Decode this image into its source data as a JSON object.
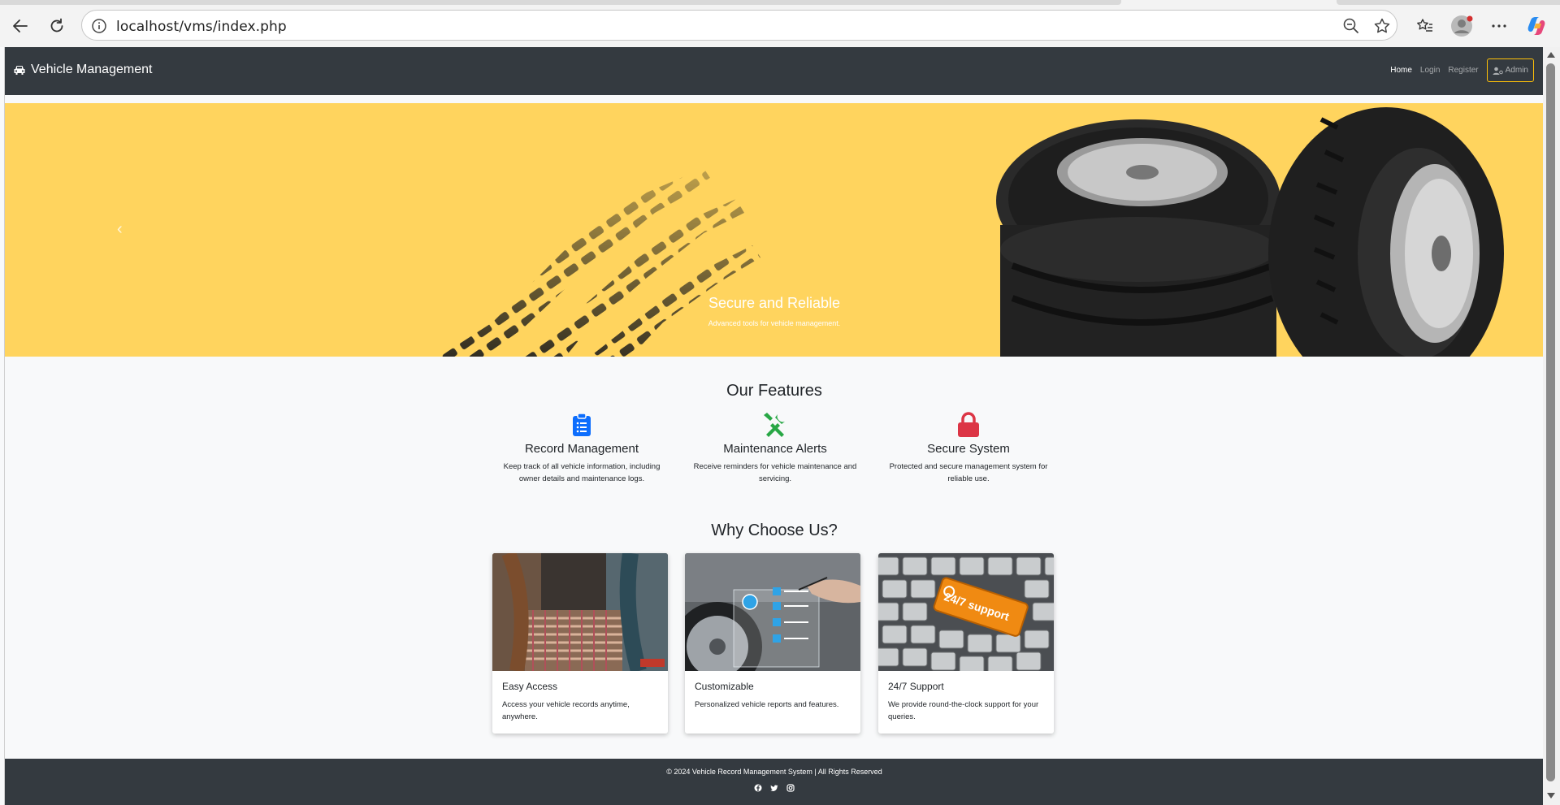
{
  "browser": {
    "url": "localhost/vms/index.php"
  },
  "navbar": {
    "brand": "Vehicle Management",
    "links": [
      {
        "label": "Home"
      },
      {
        "label": "Login"
      },
      {
        "label": "Register"
      }
    ],
    "admin_label": "Admin",
    "admin_border_color": "#ffc107"
  },
  "hero": {
    "title": "Secure and Reliable",
    "subtitle": "Advanced tools for vehicle management.",
    "prev_glyph": "‹"
  },
  "features": {
    "title": "Our Features",
    "items": [
      {
        "title": "Record Management",
        "desc": "Keep track of all vehicle information, including owner details and maintenance logs.",
        "icon": "clipboard-list-icon",
        "color": "#0d6efd"
      },
      {
        "title": "Maintenance Alerts",
        "desc": "Receive reminders for vehicle maintenance and servicing.",
        "icon": "tools-icon",
        "color": "#28a745"
      },
      {
        "title": "Secure System",
        "desc": "Protected and secure management system for reliable use.",
        "icon": "lock-icon",
        "color": "#dc3545"
      }
    ]
  },
  "why": {
    "title": "Why Choose Us?",
    "cards": [
      {
        "title": "Easy Access",
        "desc": "Access your vehicle records anytime, anywhere."
      },
      {
        "title": "Customizable",
        "desc": "Personalized vehicle reports and features."
      },
      {
        "title": "24/7 Support",
        "desc": "We provide round-the-clock support for your queries.",
        "key_text": "24/7 support"
      }
    ]
  },
  "footer": {
    "copyright": "© 2024 Vehicle Record Management System | All Rights Reserved",
    "social": [
      "facebook-icon",
      "twitter-icon",
      "instagram-icon"
    ]
  }
}
